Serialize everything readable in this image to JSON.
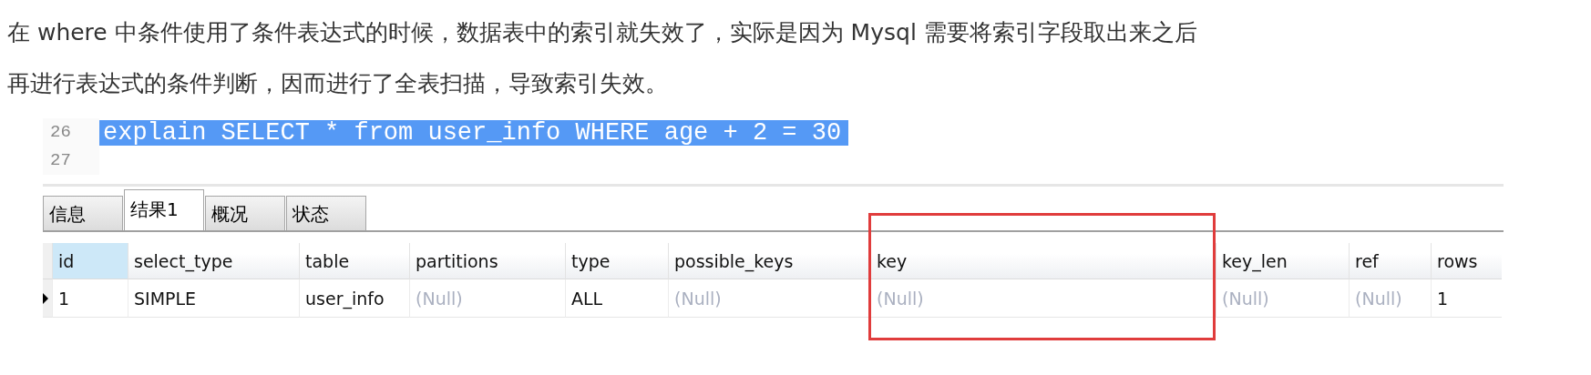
{
  "paragraph": [
    "在 where 中条件使用了条件表达式的时候，数据表中的索引就失效了，实际是因为 Mysql 需要将索引字段取出来之后",
    "再进行表达式的条件判断，因而进行了全表扫描，导致索引失效。"
  ],
  "editor": {
    "lines": [
      {
        "number": "26",
        "code": "explain SELECT * from user_info WHERE age + 2 = 30",
        "selected": true
      },
      {
        "number": "27"
      }
    ]
  },
  "tabs": [
    {
      "label": "信息",
      "selected": false
    },
    {
      "label": "结果1",
      "selected": true
    },
    {
      "label": "概况",
      "selected": false
    },
    {
      "label": "状态",
      "selected": false
    }
  ],
  "table": {
    "columns": [
      {
        "label": "id",
        "selected": true,
        "highlighted": false
      },
      {
        "label": "select_type",
        "selected": false,
        "highlighted": false
      },
      {
        "label": "table",
        "selected": false,
        "highlighted": false
      },
      {
        "label": "partitions",
        "selected": false,
        "highlighted": false
      },
      {
        "label": "type",
        "selected": false,
        "highlighted": false
      },
      {
        "label": "possible_keys",
        "selected": false,
        "highlighted": false
      },
      {
        "label": "key",
        "selected": false,
        "highlighted": true
      },
      {
        "label": "key_len",
        "selected": false,
        "highlighted": false
      },
      {
        "label": "ref",
        "selected": false,
        "highlighted": false
      },
      {
        "label": "rows",
        "selected": false,
        "highlighted": false
      }
    ],
    "rows": [
      {
        "current": true,
        "cells": [
          {
            "text": "1",
            "null": false
          },
          {
            "text": "SIMPLE",
            "null": false
          },
          {
            "text": "user_info",
            "null": false
          },
          {
            "text": "(Null)",
            "null": true
          },
          {
            "text": "ALL",
            "null": false
          },
          {
            "text": "(Null)",
            "null": true
          },
          {
            "text": "(Null)",
            "null": true
          },
          {
            "text": "(Null)",
            "null": true
          },
          {
            "text": "(Null)",
            "null": true
          },
          {
            "text": "1",
            "null": false
          }
        ]
      }
    ]
  }
}
